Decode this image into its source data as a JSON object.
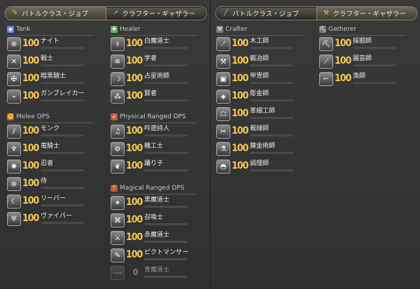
{
  "left_tabs": {
    "battle_label": "バトルクラス・ジョブ",
    "crafter_label": "クラフター・ギャザラー"
  },
  "right_tabs": {
    "battle_label": "バトルクラス・ジョブ",
    "crafter_label": "クラフター・ギャザラー"
  },
  "tank": {
    "title": "Tank",
    "jobs": [
      {
        "name": "ナイト",
        "level": "100"
      },
      {
        "name": "戦士",
        "level": "100"
      },
      {
        "name": "暗黒騎士",
        "level": "100"
      },
      {
        "name": "ガンブレイカー",
        "level": "100"
      }
    ]
  },
  "healer": {
    "title": "Healer",
    "jobs": [
      {
        "name": "白魔道士",
        "level": "100"
      },
      {
        "name": "学者",
        "level": "100"
      },
      {
        "name": "占星術師",
        "level": "100"
      },
      {
        "name": "賢者",
        "level": "100"
      }
    ]
  },
  "melee": {
    "title": "Melee DPS",
    "jobs": [
      {
        "name": "モンク",
        "level": "100"
      },
      {
        "name": "竜騎士",
        "level": "100"
      },
      {
        "name": "忍者",
        "level": "100"
      },
      {
        "name": "侍",
        "level": "100"
      },
      {
        "name": "リーパー",
        "level": "100"
      },
      {
        "name": "ヴァイパー",
        "level": "100"
      }
    ]
  },
  "ranged": {
    "title": "Physical Ranged DPS",
    "jobs": [
      {
        "name": "吟遊詩人",
        "level": "100"
      },
      {
        "name": "機工士",
        "level": "100"
      },
      {
        "name": "踊り子",
        "level": "100"
      }
    ]
  },
  "magical": {
    "title": "Magical Ranged DPS",
    "jobs": [
      {
        "name": "黒魔道士",
        "level": "100"
      },
      {
        "name": "召喚士",
        "level": "100"
      },
      {
        "name": "赤魔道士",
        "level": "100"
      },
      {
        "name": "ピクトマンサー",
        "level": "100"
      },
      {
        "name": "青魔道士",
        "level": "0"
      }
    ]
  },
  "crafter": {
    "title": "Crafter",
    "jobs": [
      {
        "name": "木工師",
        "level": "100"
      },
      {
        "name": "鍛冶師",
        "level": "100"
      },
      {
        "name": "甲冑師",
        "level": "100"
      },
      {
        "name": "彫金師",
        "level": "100"
      },
      {
        "name": "革細工師",
        "level": "100"
      },
      {
        "name": "裁縫師",
        "level": "100"
      },
      {
        "name": "錬金術師",
        "level": "100"
      },
      {
        "name": "調理師",
        "level": "100"
      }
    ]
  },
  "gatherer": {
    "title": "Gatherer",
    "jobs": [
      {
        "name": "採掘師",
        "level": "100"
      },
      {
        "name": "園芸師",
        "level": "100"
      },
      {
        "name": "漁師",
        "level": "100"
      }
    ]
  },
  "colors": {
    "tank": "#5b8ad9",
    "healer": "#62b25a",
    "dps": "#c8553d",
    "level": "#f2c94c"
  }
}
